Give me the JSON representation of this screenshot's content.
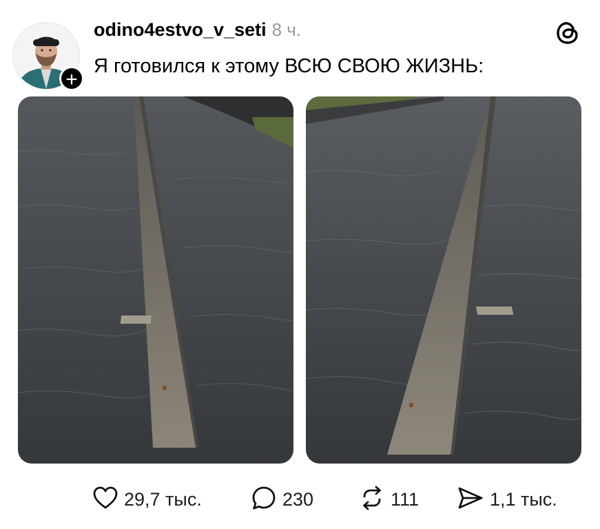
{
  "post": {
    "username": "odino4estvo_v_seti",
    "time_ago": "8 ч.",
    "text": "Я готовился к этому ВСЮ СВОЮ ЖИЗНЬ:",
    "follow_symbol": "+",
    "images": [
      {
        "description_icon": "photo-icon"
      },
      {
        "description_icon": "photo-icon"
      }
    ]
  },
  "actions": {
    "likes": "29,7 тыс.",
    "replies": "230",
    "reposts": "111",
    "shares": "1,1 тыс."
  },
  "icons": {
    "like": "heart-icon",
    "reply": "speech-bubble-icon",
    "repost": "repost-arrows-icon",
    "share": "paper-plane-icon",
    "brand": "threads-logo-icon"
  },
  "colors": {
    "text": "#000000",
    "secondary_text": "#9a9a9a",
    "badge": "#000000",
    "background": "#ffffff"
  }
}
